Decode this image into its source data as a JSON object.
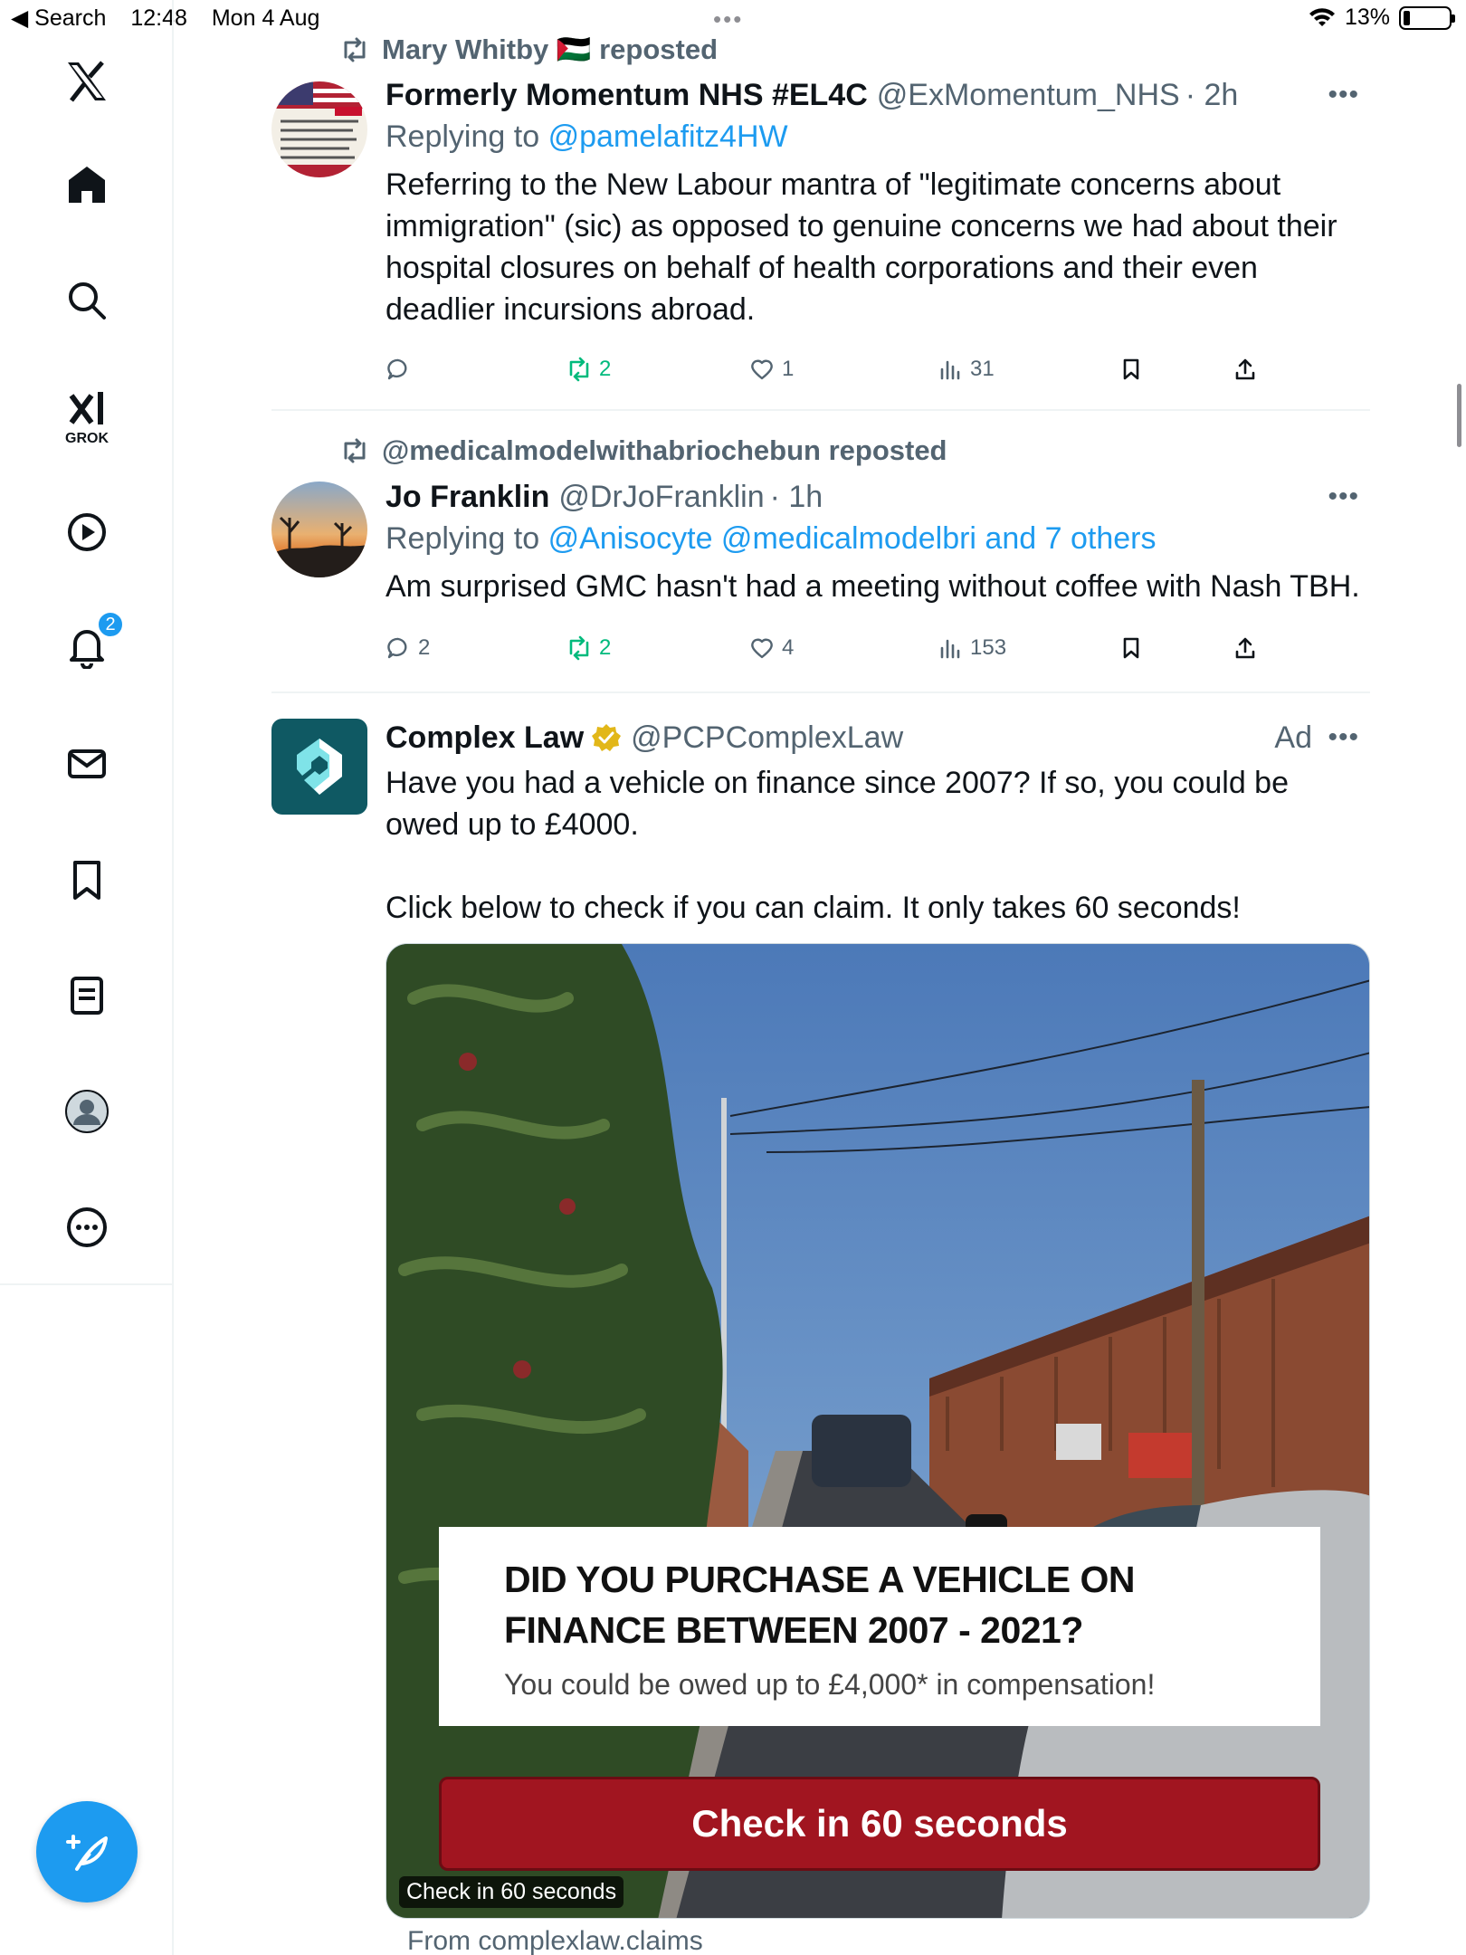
{
  "status_bar": {
    "back_label": "◀ Search",
    "time": "12:48",
    "date": "Mon 4 Aug",
    "battery": "13%"
  },
  "sidebar": {
    "grok_label": "GROK",
    "notifications_count": "2"
  },
  "posts": [
    {
      "repost_by": "Mary Whitby 🇵🇸 reposted",
      "name": "Formerly Momentum NHS #EL4C",
      "handle": "@ExMomentum_NHS",
      "time": "· 2h",
      "replying_to_label": "Replying to",
      "replying_to": "@pamelafitz4HW",
      "text": "Referring to the New Labour mantra of \"legitimate concerns about immigration\" (sic) as opposed to genuine concerns we had about their hospital closures on behalf of health corporations and their even deadlier incursions abroad.",
      "replies": "",
      "reposts": "2",
      "likes": "1",
      "views": "31"
    },
    {
      "repost_by": "@medicalmodelwithabriochebun reposted",
      "name": "Jo Franklin",
      "handle": "@DrJoFranklin",
      "time": "· 1h",
      "replying_to_label": "Replying to",
      "replying_to": "@Anisocyte @medicalmodelbri and 7 others",
      "text": "Am surprised GMC hasn't had a meeting without coffee with Nash TBH.",
      "replies": "2",
      "reposts": "2",
      "likes": "4",
      "views": "153"
    }
  ],
  "ad": {
    "name": "Complex Law",
    "handle": "@PCPComplexLaw",
    "ad_label": "Ad",
    "text_1": "Have you had a vehicle on finance since 2007? If so, you could be owed up to £4000.",
    "text_2": "Click below to check if you can claim. It only takes 60 seconds!",
    "banner_headline_1": "DID YOU PURCHASE A VEHICLE ON",
    "banner_headline_2": "FINANCE BETWEEN 2007 - 2021?",
    "banner_sub": "You could be owed up to £4,000* in compensation!",
    "cta": "Check in 60 seconds",
    "caption": "Check in 60 seconds",
    "from": "From complexlaw.claims"
  },
  "colors": {
    "accent": "#1d9bf0",
    "repost_green": "#00ba7c",
    "cta_red": "#a11520",
    "complex_law_teal": "#0f5963"
  }
}
